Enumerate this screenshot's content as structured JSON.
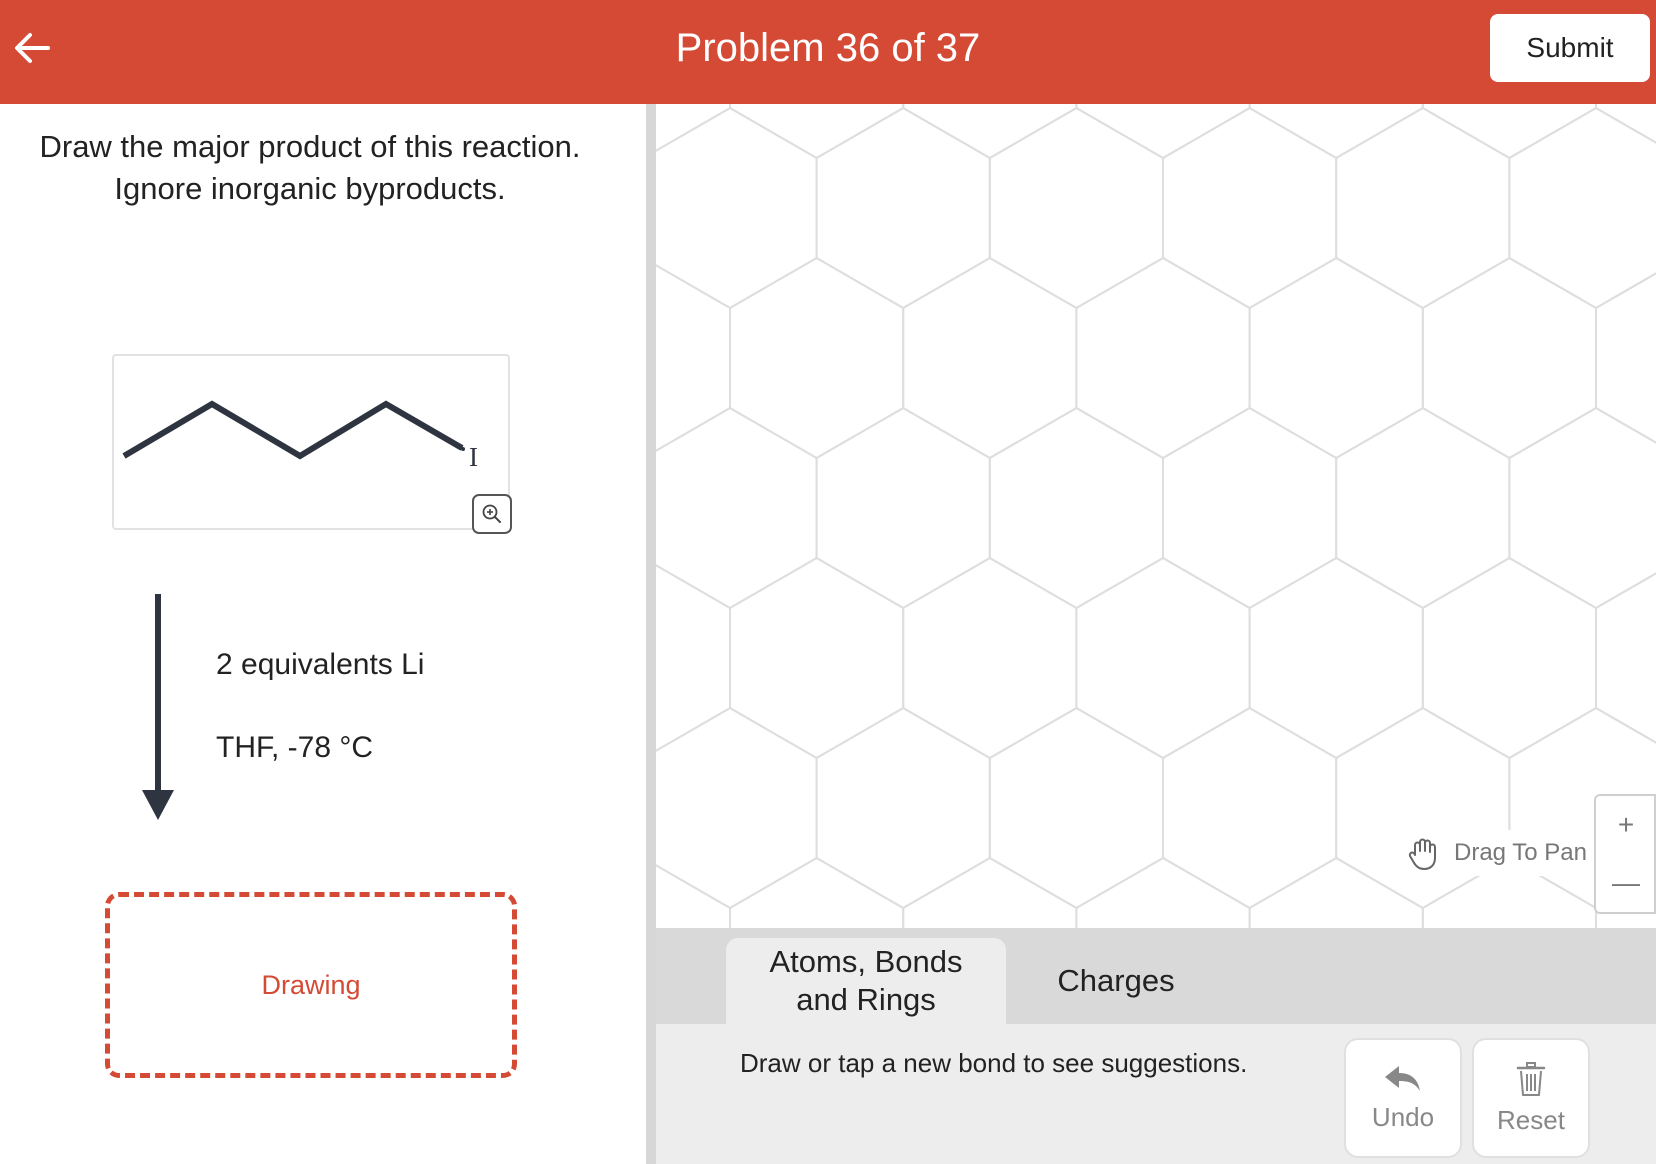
{
  "header": {
    "back_icon": "arrow-left-icon",
    "title": "Problem 36 of 37",
    "submit_label": "Submit",
    "color": "#d44a35"
  },
  "question": {
    "instructions": "Draw the major product of this reaction. Ignore inorganic byproducts.",
    "reactant": {
      "structure": "skeletal chain ending in iodine",
      "atom_label": "I",
      "zoom_icon": "zoom-in-icon"
    },
    "reagents": [
      "2 equivalents Li",
      "THF, -78 °C"
    ],
    "answer_placeholder": "Drawing"
  },
  "canvas": {
    "grid": "hexagonal",
    "drag_hint": "Drag To Pan",
    "drag_icon": "hand-icon",
    "zoom_in_label": "+",
    "zoom_out_label": "—"
  },
  "toolbar": {
    "tabs": [
      {
        "label": "Atoms, Bonds and Rings",
        "active": true
      },
      {
        "label": "Charges",
        "active": false
      }
    ],
    "hint": "Draw or tap a new bond to see suggestions.",
    "undo_label": "Undo",
    "undo_icon": "undo-icon",
    "reset_label": "Reset",
    "reset_icon": "trash-icon"
  }
}
